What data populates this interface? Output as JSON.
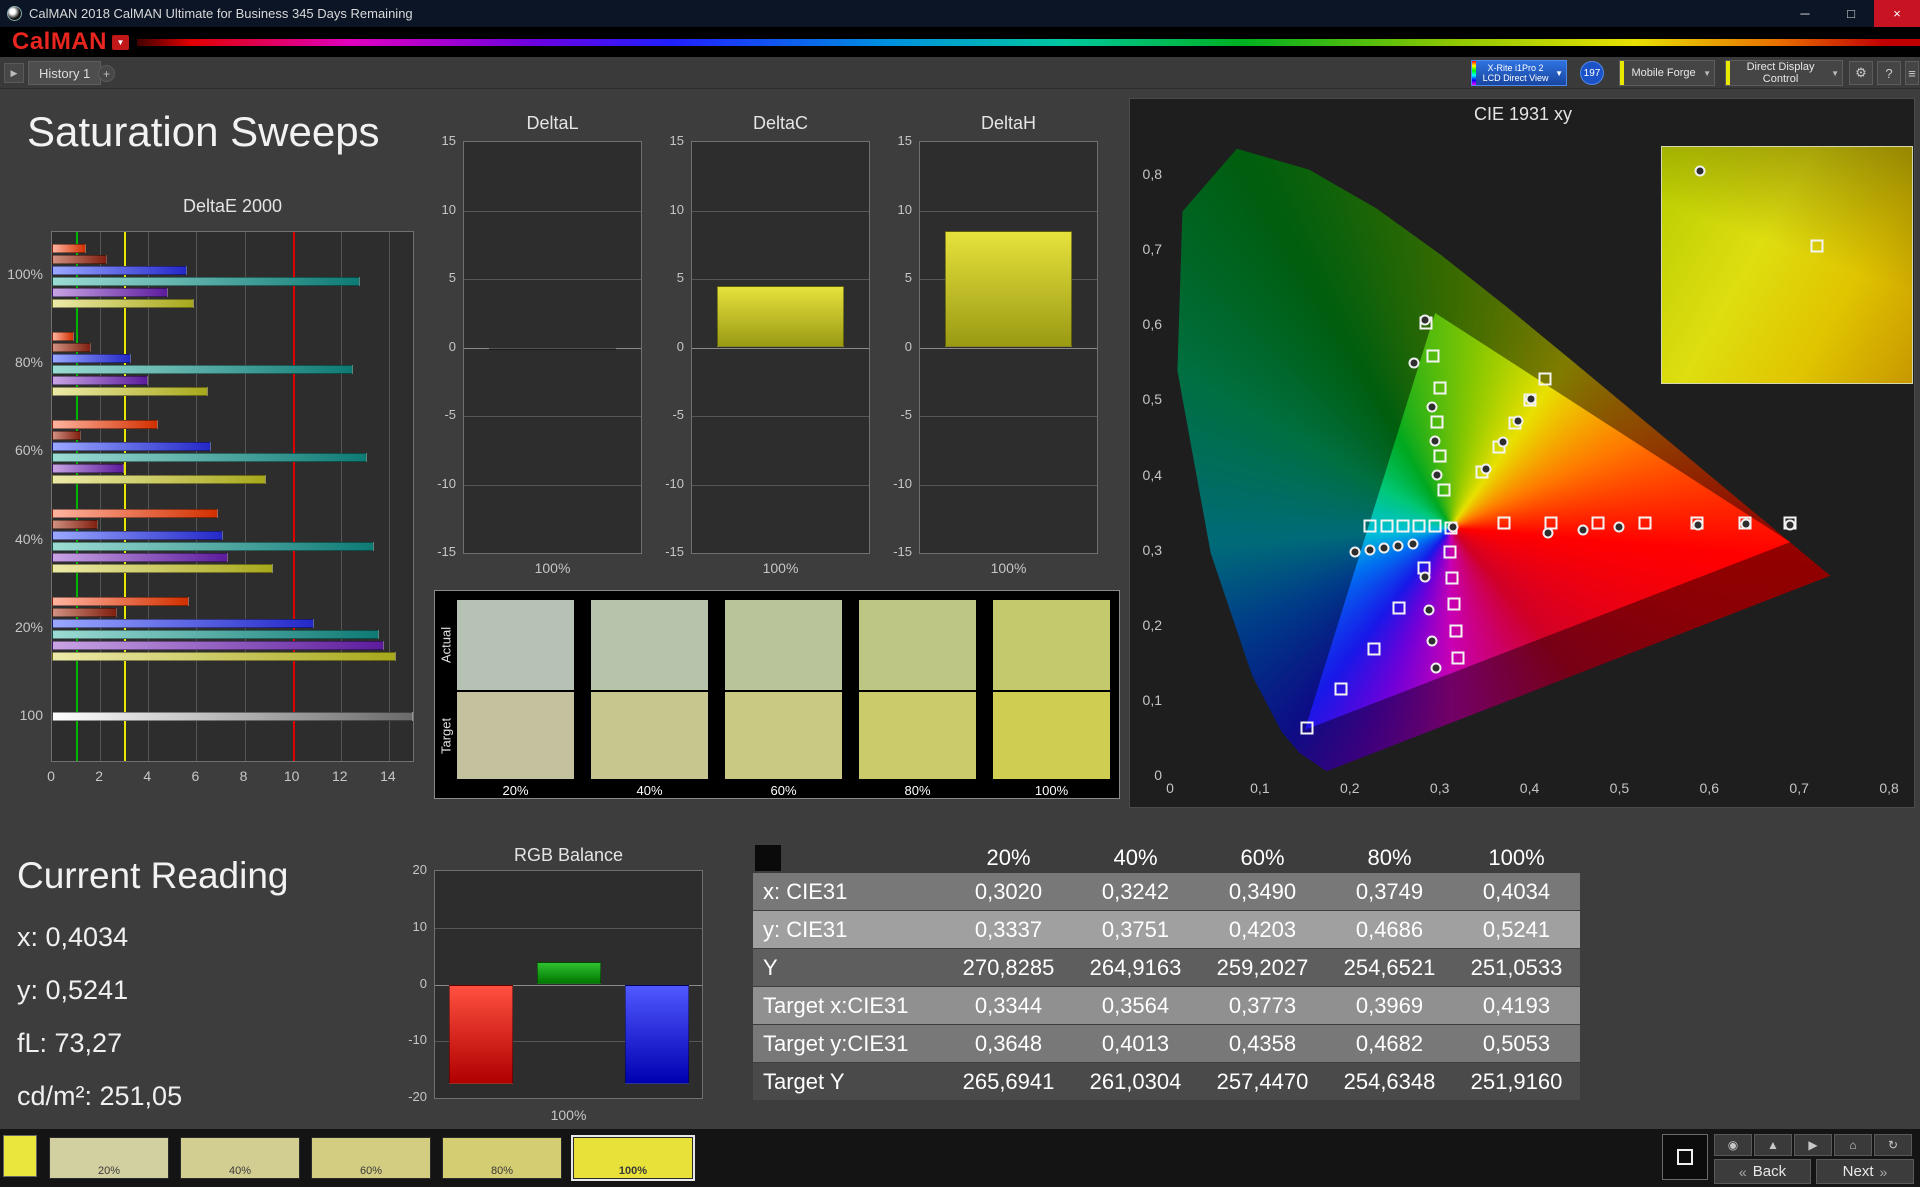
{
  "window": {
    "title": "CalMAN 2018 CalMAN Ultimate for Business 345 Days Remaining",
    "logo": "CalMAN"
  },
  "icons": {
    "dropdown": "▼",
    "minimize": "─",
    "maximize": "□",
    "close": "×",
    "gear": "⚙",
    "help": "?",
    "menu": "≡",
    "back": "«",
    "next": "»",
    "history_arrow": "▶",
    "add_tab": "+"
  },
  "toolbar": {
    "history_tab": "History 1",
    "meter": {
      "line1": "X-Rite i1Pro 2",
      "line2": "LCD Direct View"
    },
    "badge": "197",
    "source": "Mobile Forge",
    "display": "Direct Display Control"
  },
  "page": {
    "title": "Saturation Sweeps"
  },
  "current_reading": {
    "title": "Current Reading",
    "lines": [
      "x: 0,4034",
      "y: 0,5241",
      "fL: 73,27",
      "cd/m²: 251,05"
    ]
  },
  "table": {
    "columns": [
      "20%",
      "40%",
      "60%",
      "80%",
      "100%"
    ],
    "rows": [
      {
        "label": "x: CIE31",
        "values": [
          "0,3020",
          "0,3242",
          "0,3490",
          "0,3749",
          "0,4034"
        ]
      },
      {
        "label": "y: CIE31",
        "values": [
          "0,3337",
          "0,3751",
          "0,4203",
          "0,4686",
          "0,5241"
        ]
      },
      {
        "label": "Y",
        "values": [
          "270,8285",
          "264,9163",
          "259,2027",
          "254,6521",
          "251,0533"
        ]
      },
      {
        "label": "Target x:CIE31",
        "values": [
          "0,3344",
          "0,3564",
          "0,3773",
          "0,3969",
          "0,4193"
        ]
      },
      {
        "label": "Target y:CIE31",
        "values": [
          "0,3648",
          "0,4013",
          "0,4358",
          "0,4682",
          "0,5053"
        ]
      },
      {
        "label": "Target Y",
        "values": [
          "265,6941",
          "261,0304",
          "257,4470",
          "254,6348",
          "251,9160"
        ]
      }
    ]
  },
  "swatch_compare": {
    "actual_label": "Actual",
    "target_label": "Target",
    "columns": [
      {
        "label": "20%",
        "actual": "#b6c2b4",
        "target": "#c4c29e"
      },
      {
        "label": "40%",
        "actual": "#b7c3aa",
        "target": "#c7c68f"
      },
      {
        "label": "60%",
        "actual": "#bac49b",
        "target": "#cac983"
      },
      {
        "label": "80%",
        "actual": "#bec684",
        "target": "#cccb6c"
      },
      {
        "label": "100%",
        "actual": "#c4c96e",
        "target": "#cfce52"
      }
    ]
  },
  "bottom_bar": {
    "current_color": "#eae63c",
    "swatches": [
      {
        "label": "20%",
        "color": "#d2cfa0",
        "selected": false
      },
      {
        "label": "40%",
        "color": "#d2cd90",
        "selected": false
      },
      {
        "label": "60%",
        "color": "#d3cd82",
        "selected": false
      },
      {
        "label": "80%",
        "color": "#d4cd72",
        "selected": false
      },
      {
        "label": "100%",
        "color": "#e7e13a",
        "selected": true
      }
    ],
    "tool_buttons": [
      {
        "name": "camera",
        "glyph": "◉"
      },
      {
        "name": "eject",
        "glyph": "▲"
      },
      {
        "name": "play",
        "glyph": "▶"
      },
      {
        "name": "home",
        "glyph": "⌂"
      },
      {
        "name": "refresh",
        "glyph": "↻"
      }
    ],
    "nav": {
      "back": "Back",
      "next": "Next"
    }
  },
  "chart_data": [
    {
      "id": "deltae2000",
      "type": "bar",
      "orientation": "horizontal",
      "title": "DeltaE 2000",
      "xlim": [
        0,
        15
      ],
      "x_ticks": [
        0,
        2,
        4,
        6,
        8,
        10,
        12,
        14
      ],
      "reference_lines": [
        {
          "value": 1,
          "color": "#00b400"
        },
        {
          "value": 3,
          "color": "#e6e600"
        },
        {
          "value": 10,
          "color": "#dc0000"
        }
      ],
      "series": [
        {
          "name": "red",
          "from": "#ffb4a0",
          "to": "#d23000"
        },
        {
          "name": "dark-red",
          "from": "#d09080",
          "to": "#802010"
        },
        {
          "name": "blue",
          "from": "#9aa8ff",
          "to": "#2428c8"
        },
        {
          "name": "teal",
          "from": "#9cdcd4",
          "to": "#0e7a74"
        },
        {
          "name": "purple",
          "from": "#c8a4e4",
          "to": "#5c1c9c"
        },
        {
          "name": "yellow",
          "from": "#eceaa8",
          "to": "#a8a81c"
        },
        {
          "name": "gray",
          "from": "#ffffff",
          "to": "#6a6a6a"
        }
      ],
      "groups": [
        {
          "label": "100%",
          "bars": [
            {
              "v": 1.4,
              "s": 0
            },
            {
              "v": 2.3,
              "s": 1
            },
            {
              "v": 5.6,
              "s": 2
            },
            {
              "v": 12.8,
              "s": 3
            },
            {
              "v": 4.8,
              "s": 4
            },
            {
              "v": 5.9,
              "s": 5
            }
          ]
        },
        {
          "label": "80%",
          "bars": [
            {
              "v": 0.9,
              "s": 0
            },
            {
              "v": 1.6,
              "s": 1
            },
            {
              "v": 3.3,
              "s": 2
            },
            {
              "v": 12.5,
              "s": 3
            },
            {
              "v": 4.0,
              "s": 4
            },
            {
              "v": 6.5,
              "s": 5
            }
          ]
        },
        {
          "label": "60%",
          "bars": [
            {
              "v": 4.4,
              "s": 0
            },
            {
              "v": 1.2,
              "s": 1
            },
            {
              "v": 6.6,
              "s": 2
            },
            {
              "v": 13.1,
              "s": 3
            },
            {
              "v": 3.0,
              "s": 4
            },
            {
              "v": 8.9,
              "s": 5
            }
          ]
        },
        {
          "label": "40%",
          "bars": [
            {
              "v": 6.9,
              "s": 0
            },
            {
              "v": 1.9,
              "s": 1
            },
            {
              "v": 7.1,
              "s": 2
            },
            {
              "v": 13.4,
              "s": 3
            },
            {
              "v": 7.3,
              "s": 4
            },
            {
              "v": 9.2,
              "s": 5
            }
          ]
        },
        {
          "label": "20%",
          "bars": [
            {
              "v": 5.7,
              "s": 0
            },
            {
              "v": 2.7,
              "s": 1
            },
            {
              "v": 10.9,
              "s": 2
            },
            {
              "v": 13.6,
              "s": 3
            },
            {
              "v": 13.8,
              "s": 4
            },
            {
              "v": 14.3,
              "s": 5
            }
          ]
        },
        {
          "label": "100",
          "bars": [
            {
              "v": 15.5,
              "s": 6
            }
          ]
        }
      ]
    },
    {
      "id": "deltaL",
      "type": "bar",
      "title": "DeltaL",
      "ylim": [
        -15,
        15
      ],
      "y_ticks": [
        15,
        10,
        5,
        0,
        -5,
        -10,
        -15
      ],
      "xlabel": "100%",
      "value": -0.1,
      "bar_from": "#161616",
      "bar_to": "#000000"
    },
    {
      "id": "deltaC",
      "type": "bar",
      "title": "DeltaC",
      "ylim": [
        -15,
        15
      ],
      "y_ticks": [
        15,
        10,
        5,
        0,
        -5,
        -10,
        -15
      ],
      "xlabel": "100%",
      "value": 4.5,
      "bar_from": "#e6e23c",
      "bar_to": "#9a9a14"
    },
    {
      "id": "deltaH",
      "type": "bar",
      "title": "DeltaH",
      "ylim": [
        -15,
        15
      ],
      "y_ticks": [
        15,
        10,
        5,
        0,
        -5,
        -10,
        -15
      ],
      "xlabel": "100%",
      "value": 8.5,
      "bar_from": "#e6e23c",
      "bar_to": "#9a9a14"
    },
    {
      "id": "rgb_balance",
      "type": "bar",
      "title": "RGB Balance",
      "ylim": [
        -20,
        20
      ],
      "y_ticks": [
        20,
        10,
        0,
        -10,
        -20
      ],
      "xlabel": "100%",
      "categories": [
        "red",
        "green",
        "blue"
      ],
      "values": [
        -17.5,
        4,
        -17.5
      ],
      "colors": [
        [
          "#ff5040",
          "#b00000"
        ],
        [
          "#30c030",
          "#007800"
        ],
        [
          "#5058ff",
          "#0000b0"
        ]
      ]
    },
    {
      "id": "cie1931",
      "type": "scatter",
      "title": "CIE 1931 xy",
      "xlim": [
        0,
        0.8
      ],
      "ylim": [
        0,
        0.8
      ],
      "x_ticks": [
        {
          "v": 0,
          "label": "0"
        },
        {
          "v": 0.1,
          "label": "0,1"
        },
        {
          "v": 0.2,
          "label": "0,2"
        },
        {
          "v": 0.3,
          "label": "0,3"
        },
        {
          "v": 0.4,
          "label": "0,4"
        },
        {
          "v": 0.5,
          "label": "0,5"
        },
        {
          "v": 0.6,
          "label": "0,6"
        },
        {
          "v": 0.7,
          "label": "0,7"
        },
        {
          "v": 0.8,
          "label": "0,8"
        }
      ],
      "y_ticks": [
        {
          "v": 0,
          "label": "0"
        },
        {
          "v": 0.1,
          "label": "0,1"
        },
        {
          "v": 0.2,
          "label": "0,2"
        },
        {
          "v": 0.3,
          "label": "0,3"
        },
        {
          "v": 0.4,
          "label": "0,4"
        },
        {
          "v": 0.5,
          "label": "0,5"
        },
        {
          "v": 0.6,
          "label": "0,6"
        },
        {
          "v": 0.7,
          "label": "0,7"
        },
        {
          "v": 0.8,
          "label": "0,8"
        }
      ],
      "white_point": {
        "x": 0.3127,
        "y": 0.329
      },
      "locus": [
        [
          0.1741,
          0.005
        ],
        [
          0.144,
          0.0297
        ],
        [
          0.1241,
          0.0578
        ],
        [
          0.0913,
          0.1327
        ],
        [
          0.0454,
          0.295
        ],
        [
          0.0082,
          0.5384
        ],
        [
          0.0139,
          0.7502
        ],
        [
          0.0743,
          0.8338
        ],
        [
          0.1547,
          0.8059
        ],
        [
          0.2296,
          0.7543
        ],
        [
          0.3016,
          0.6923
        ],
        [
          0.3731,
          0.6245
        ],
        [
          0.4441,
          0.5547
        ],
        [
          0.5125,
          0.4866
        ],
        [
          0.5752,
          0.4242
        ],
        [
          0.627,
          0.3725
        ],
        [
          0.6915,
          0.3083
        ],
        [
          0.7347,
          0.2653
        ]
      ],
      "gamut_triangle": [
        [
          0.69,
          0.31
        ],
        [
          0.295,
          0.615
        ],
        [
          0.15,
          0.06
        ]
      ],
      "targets": [
        [
          0.313,
          0.329
        ],
        [
          0.305,
          0.38
        ],
        [
          0.3,
          0.425
        ],
        [
          0.297,
          0.47
        ],
        [
          0.3,
          0.515
        ],
        [
          0.293,
          0.558
        ],
        [
          0.285,
          0.602
        ],
        [
          0.347,
          0.403
        ],
        [
          0.366,
          0.437
        ],
        [
          0.384,
          0.468
        ],
        [
          0.401,
          0.499
        ],
        [
          0.417,
          0.527
        ],
        [
          0.372,
          0.335
        ],
        [
          0.424,
          0.335
        ],
        [
          0.476,
          0.335
        ],
        [
          0.528,
          0.335
        ],
        [
          0.586,
          0.335
        ],
        [
          0.64,
          0.335
        ],
        [
          0.69,
          0.335
        ],
        [
          0.295,
          0.332
        ],
        [
          0.277,
          0.332
        ],
        [
          0.259,
          0.332
        ],
        [
          0.241,
          0.332
        ],
        [
          0.222,
          0.332
        ],
        [
          0.312,
          0.297
        ],
        [
          0.314,
          0.262
        ],
        [
          0.316,
          0.227
        ],
        [
          0.318,
          0.192
        ],
        [
          0.32,
          0.156
        ],
        [
          0.283,
          0.276
        ],
        [
          0.255,
          0.222
        ],
        [
          0.227,
          0.168
        ],
        [
          0.19,
          0.115
        ],
        [
          0.152,
          0.062
        ]
      ],
      "measurements": [
        [
          0.284,
          0.606
        ],
        [
          0.272,
          0.548
        ],
        [
          0.297,
          0.4
        ],
        [
          0.295,
          0.445
        ],
        [
          0.292,
          0.49
        ],
        [
          0.352,
          0.408
        ],
        [
          0.37,
          0.443
        ],
        [
          0.387,
          0.471
        ],
        [
          0.402,
          0.5
        ],
        [
          0.42,
          0.322
        ],
        [
          0.46,
          0.326
        ],
        [
          0.5,
          0.33
        ],
        [
          0.587,
          0.333
        ],
        [
          0.641,
          0.334
        ],
        [
          0.69,
          0.333
        ],
        [
          0.206,
          0.297
        ],
        [
          0.222,
          0.3
        ],
        [
          0.238,
          0.302
        ],
        [
          0.254,
          0.305
        ],
        [
          0.27,
          0.308
        ],
        [
          0.284,
          0.263
        ],
        [
          0.288,
          0.22
        ],
        [
          0.292,
          0.178
        ],
        [
          0.296,
          0.142
        ],
        [
          0.315,
          0.33
        ]
      ],
      "inset": {
        "circle": [
          0.15,
          0.1
        ],
        "square": [
          0.62,
          0.42
        ]
      }
    }
  ]
}
